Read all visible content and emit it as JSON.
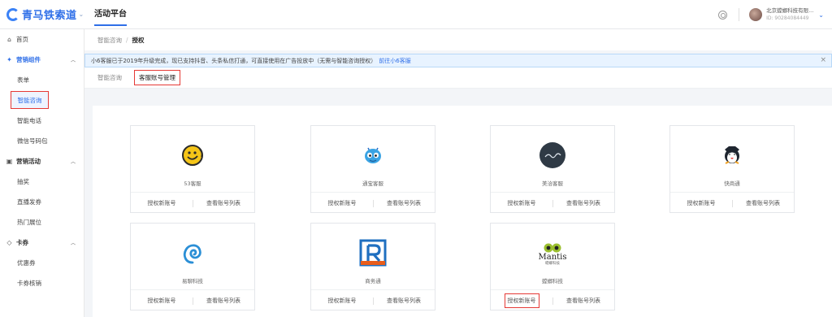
{
  "header": {
    "logo_text": "青马铁索道",
    "logo_caret": "⌄",
    "platform_tab": "活动平台",
    "user_name": "北京螳螂科技有限...",
    "user_id": "ID: 90284084449",
    "user_caret": "⌄"
  },
  "sidebar": {
    "home": "首页",
    "groups": [
      {
        "label": "营销组件",
        "icon": "puzzle-icon",
        "items": [
          "表单",
          "智能咨询",
          "智能电话",
          "微信号码包"
        ]
      },
      {
        "label": "营销活动",
        "icon": "gift-icon",
        "items": [
          "抽奖",
          "直播发券",
          "热门展位"
        ]
      },
      {
        "label": "卡券",
        "icon": "tag-icon",
        "items": [
          "优惠券",
          "卡券核销"
        ]
      }
    ],
    "selected_item": "智能咨询"
  },
  "breadcrumb": {
    "parent": "智能咨询",
    "separator": "/",
    "current": "授权"
  },
  "notice": {
    "text": "小6客服已于2019年升级完成，现已支持抖音、头条私信打通，可直接使用在广告投放中（无需与智能咨询授权）",
    "link": "前往小6客服",
    "close": "×"
  },
  "tabs": {
    "tab1": "智能咨询",
    "tab2": "客服账号管理",
    "active": "客服账号管理"
  },
  "cards": [
    {
      "name": "53客服",
      "icon": "smiley-icon",
      "btn_auth": "授权新账号",
      "btn_list": "查看账号列表"
    },
    {
      "name": "通宝客服",
      "icon": "ant-icon",
      "btn_auth": "授权新账号",
      "btn_list": "查看账号列表"
    },
    {
      "name": "美洽客服",
      "icon": "chat-circle-icon",
      "btn_auth": "授权新账号",
      "btn_list": "查看账号列表"
    },
    {
      "name": "快商通",
      "icon": "penguin-icon",
      "btn_auth": "授权新账号",
      "btn_list": "查看账号列表"
    },
    {
      "name": "易聊科技",
      "icon": "spiral-icon",
      "btn_auth": "授权新账号",
      "btn_list": "查看账号列表"
    },
    {
      "name": "商务通",
      "icon": "r-letter-icon",
      "btn_auth": "授权新账号",
      "btn_list": "查看账号列表"
    },
    {
      "name": "螳螂科技",
      "icon": "mantis-icon",
      "logo_word": "Mantis",
      "logo_sub": "螳螂科技",
      "btn_auth": "授权新账号",
      "btn_list": "查看账号列表"
    }
  ],
  "colors": {
    "accent": "#2f6fe8",
    "highlight": "#e53935"
  }
}
